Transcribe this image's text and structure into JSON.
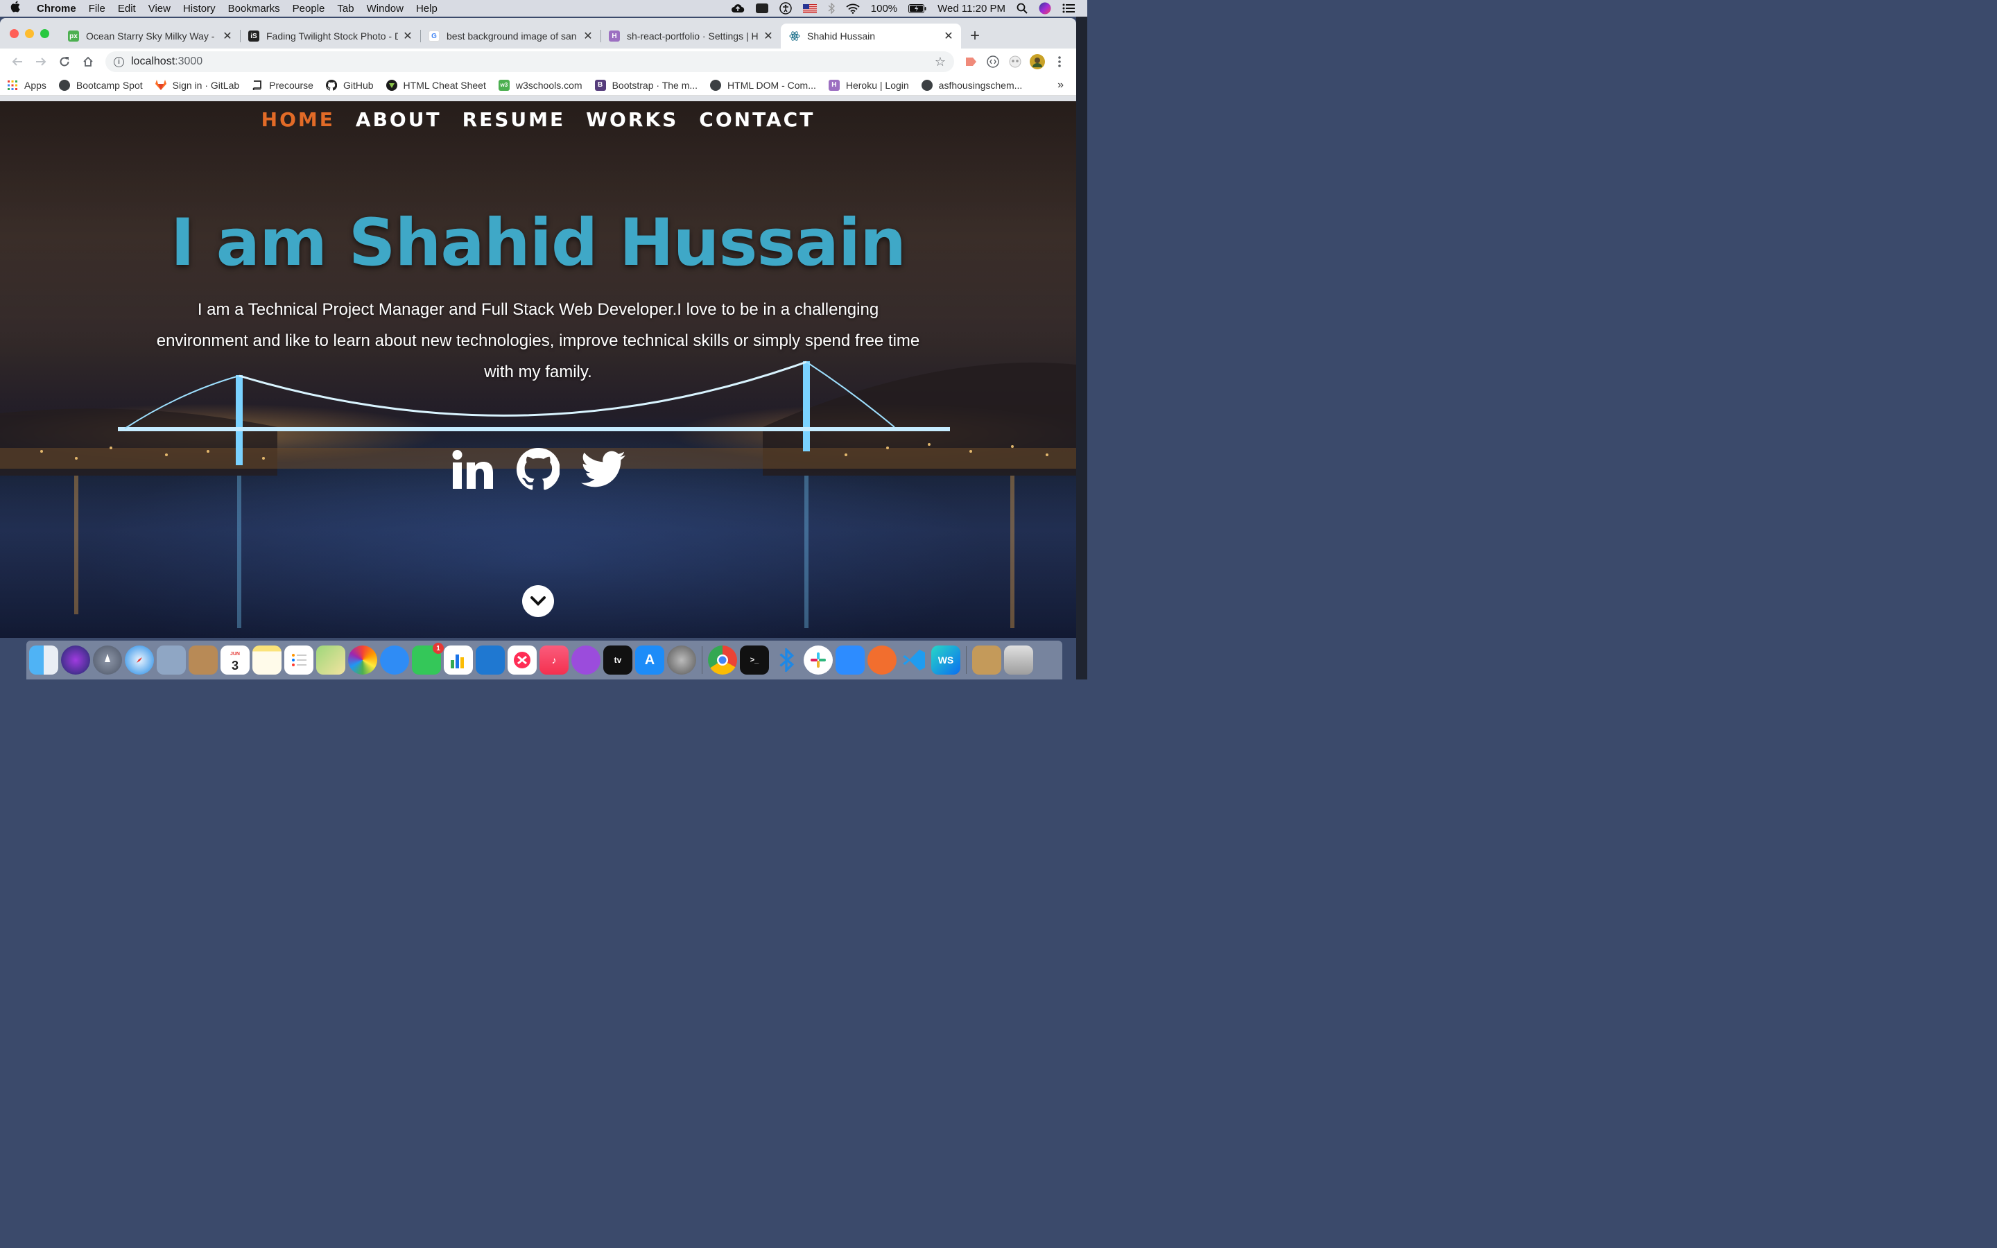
{
  "menubar": {
    "app": "Chrome",
    "items": [
      "File",
      "Edit",
      "View",
      "History",
      "Bookmarks",
      "People",
      "Tab",
      "Window",
      "Help"
    ],
    "battery": "100%",
    "clock": "Wed 11:20 PM"
  },
  "tabs": [
    {
      "title": "Ocean Starry Sky Milky Way - P",
      "favicon": "px",
      "favicon_color": "#4caf50"
    },
    {
      "title": "Fading Twilight Stock Photo - D",
      "favicon": "iS",
      "favicon_color": "#222222"
    },
    {
      "title": "best background image of san",
      "favicon": "G",
      "favicon_color": "#4285f4"
    },
    {
      "title": "sh-react-portfolio · Settings | H",
      "favicon": "H",
      "favicon_color": "#9c6fc1"
    },
    {
      "title": "Shahid Hussain",
      "favicon": "react",
      "favicon_color": "#61dafb",
      "active": true
    }
  ],
  "address": {
    "host": "localhost",
    "port": ":3000"
  },
  "bookmarks": [
    {
      "label": "Apps",
      "icon": "apps-grid-icon"
    },
    {
      "label": "Bootcamp Spot",
      "icon": "globe-icon"
    },
    {
      "label": "Sign in · GitLab",
      "icon": "gitlab-icon"
    },
    {
      "label": "Precourse",
      "icon": "book-icon"
    },
    {
      "label": "GitHub",
      "icon": "github-icon"
    },
    {
      "label": "HTML Cheat Sheet",
      "icon": "html-icon"
    },
    {
      "label": "w3schools.com",
      "icon": "w3-icon"
    },
    {
      "label": "Bootstrap · The m...",
      "icon": "bootstrap-icon"
    },
    {
      "label": "HTML DOM - Com...",
      "icon": "globe-icon"
    },
    {
      "label": "Heroku | Login",
      "icon": "heroku-icon"
    },
    {
      "label": "asfhousingschem...",
      "icon": "globe-icon"
    }
  ],
  "site": {
    "nav": [
      {
        "label": "HOME",
        "active": true
      },
      {
        "label": "ABOUT"
      },
      {
        "label": "RESUME"
      },
      {
        "label": "WORKS"
      },
      {
        "label": "CONTACT"
      }
    ],
    "title": "I am Shahid Hussain",
    "bio": "I am a Technical Project Manager and Full Stack Web Developer.I love to be in a challenging environment and like to learn about new technologies, improve technical skills or simply spend free time with my family.",
    "socials": [
      "linkedin-icon",
      "github-icon",
      "twitter-icon"
    ],
    "accent_color": "#3fa8c7",
    "active_nav_color": "#e26b27"
  },
  "dock": {
    "calendar_day": "3",
    "calendar_month": "JUN",
    "facetime_badge": "1"
  }
}
